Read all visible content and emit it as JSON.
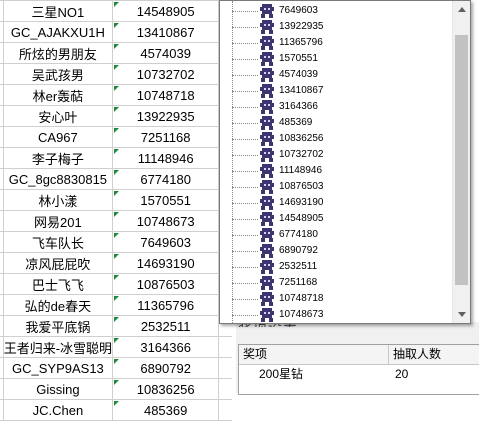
{
  "sheet": {
    "rows": [
      {
        "name": "三星NO1",
        "num": "14548905"
      },
      {
        "name": "GC_AJAKXU1H",
        "num": "13410867"
      },
      {
        "name": "所炫的男朋友",
        "num": "4574039"
      },
      {
        "name": "吴武孩男",
        "num": "10732702"
      },
      {
        "name": "林er轰萜",
        "num": "10748718"
      },
      {
        "name": "安心叶",
        "num": "13922935"
      },
      {
        "name": "CA967",
        "num": "7251168"
      },
      {
        "name": "李子梅子",
        "num": "11148946"
      },
      {
        "name": "GC_8gc8830815",
        "num": "6774180"
      },
      {
        "name": "林小漾",
        "num": "1570551"
      },
      {
        "name": "网易201",
        "num": "10748673"
      },
      {
        "name": "飞车队长",
        "num": "7649603"
      },
      {
        "name": "凉风屁屁吹",
        "num": "14693190"
      },
      {
        "name": "巴士飞飞",
        "num": "10876503"
      },
      {
        "name": "弘的de春天",
        "num": "11365796"
      },
      {
        "name": "我爱平底锅",
        "num": "2532511"
      },
      {
        "name": "王者归来-冰雪聪明",
        "num": "3164366"
      },
      {
        "name": "GC_SYP9AS13",
        "num": "6890792"
      },
      {
        "name": "Gissing",
        "num": "10836256"
      },
      {
        "name": "JC.Chen",
        "num": "485369"
      }
    ]
  },
  "popup": {
    "items": [
      "7649603",
      "13922935",
      "11365796",
      "1570551",
      "4574039",
      "13410867",
      "3164366",
      "485369",
      "10836256",
      "10732702",
      "11148946",
      "10876503",
      "14693190",
      "14548905",
      "6774180",
      "6890792",
      "2532511",
      "7251168",
      "10748718",
      "10748673"
    ]
  },
  "prize": {
    "title_fragment": "奖项设置",
    "columns": [
      "奖项",
      "抽取人数"
    ],
    "row": {
      "prize": "200星钻",
      "count": "20"
    }
  },
  "colors": {
    "accent_marker": "#1e8a3a",
    "tree_icon": "#3b3570"
  }
}
